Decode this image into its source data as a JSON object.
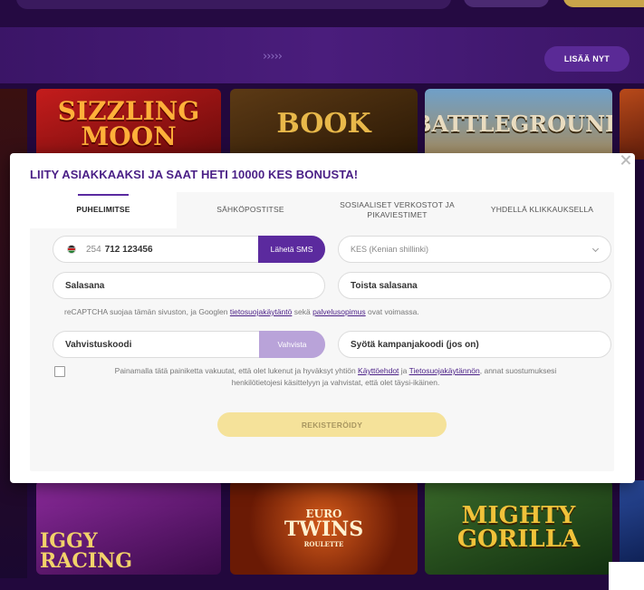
{
  "background": {
    "arrows": "›››››",
    "more_button": "LISÄÄ NYT",
    "tiles": [
      {
        "line1": "SIZZLING",
        "line2": "MOON"
      },
      {
        "line1": "BOOK",
        "line2": ""
      },
      {
        "line1": "BATTLEGROUND",
        "line2": ""
      },
      {
        "line1": "IGGY",
        "line2": "RACING"
      },
      {
        "line1": "EURO",
        "line2": "TWINS"
      },
      {
        "line1": "MIGHTY",
        "line2": "GORILLA"
      }
    ],
    "tile_sub": "ROULETTE"
  },
  "modal": {
    "title": "LIITY ASIAKKAAKSI JA SAAT HETI 10000 KES BONUSTA!",
    "tabs": [
      {
        "label": "PUHELIMITSE"
      },
      {
        "label": "SÄHKÖPOSTITSE"
      },
      {
        "label": "SOSIAALISET VERKOSTOT JA PIKAVIESTIMET"
      },
      {
        "label": "YHDELLÄ KLIKKAUKSELLA"
      }
    ],
    "phone": {
      "prefix": "254",
      "number": "712 123456",
      "sms_button": "Lähetä SMS"
    },
    "currency": "KES (Kenian shillinki)",
    "password": "Salasana",
    "password_repeat": "Toista salasana",
    "recaptcha": {
      "text1": "reCAPTCHA suojaa tämän sivuston, ja Googlen ",
      "link1": "tietosuojakäytäntö",
      "text2": " sekä ",
      "link2": "palvelusopimus",
      "text3": " ovat voimassa."
    },
    "verification_code": "Vahvistuskoodi",
    "verify_button": "Vahvista",
    "promo_code": "Syötä kampanjakoodi (jos on)",
    "terms": {
      "text1": "Painamalla tätä painiketta vakuutat, että olet lukenut ja hyväksyt yhtiön ",
      "link1": "Käyttöehdot",
      "text2": " ja ",
      "link2": "Tietosuojakäytännön",
      "text3": ", annat suostumuksesi henkilötietojesi käsittelyyn ja vahvistat, että olet täysi-ikäinen."
    },
    "register_button": "REKISTERÖIDY"
  },
  "colors": {
    "accent": "#5b2a9e",
    "title": "#4a1f86",
    "register": "#f5e29a",
    "verify": "#b9a3d9"
  }
}
